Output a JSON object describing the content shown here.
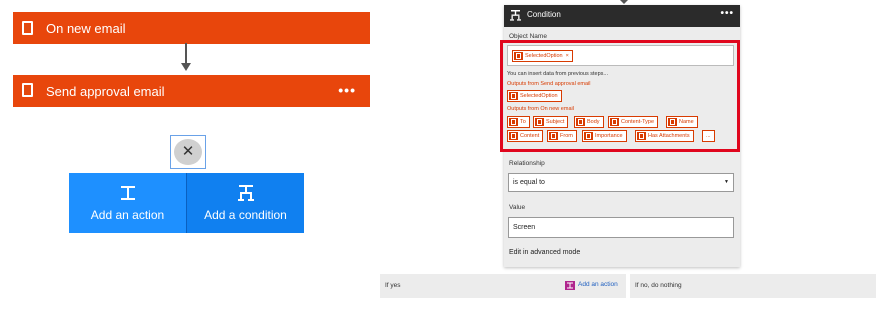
{
  "flow": {
    "trigger_label": "On new email",
    "action_label": "Send approval email",
    "action_more": "•••",
    "close_glyph": "✕",
    "add_action_label": "Add an action",
    "add_condition_label": "Add a condition"
  },
  "condition": {
    "title": "Condition",
    "more": "•••",
    "object_name_label": "Object Name",
    "selected_token": "SelectedOption",
    "selected_token_remove": "×",
    "insert_hint": "You can insert data from previous steps...",
    "group1_label": "Outputs from Send approval email",
    "group1_tokens": [
      "SelectedOption"
    ],
    "group2_label": "Outputs from On new email",
    "group2_tokens_row1": [
      "To",
      "Subject",
      "Body",
      "Content-Type",
      "Name"
    ],
    "group2_tokens_row2": [
      "Content",
      "From",
      "Importance",
      "Has Attachments"
    ],
    "group2_more": "...",
    "relationship_label": "Relationship",
    "relationship_value": "is equal to",
    "relationship_caret": "▼",
    "value_label": "Value",
    "value_value": "Screen",
    "advanced_link": "Edit in advanced mode"
  },
  "branches": {
    "yes_label": "If yes",
    "yes_add_action": "Add an action",
    "no_label": "If no, do nothing"
  },
  "colors": {
    "office_orange": "#e8460c",
    "action_blue": "#1e90ff",
    "highlight_red": "#e0061d",
    "condition_header": "#2b2b2b"
  },
  "icons": {
    "card": "office-logo-icon",
    "action": "add-action-icon",
    "condition": "add-condition-icon",
    "close": "close-icon"
  }
}
